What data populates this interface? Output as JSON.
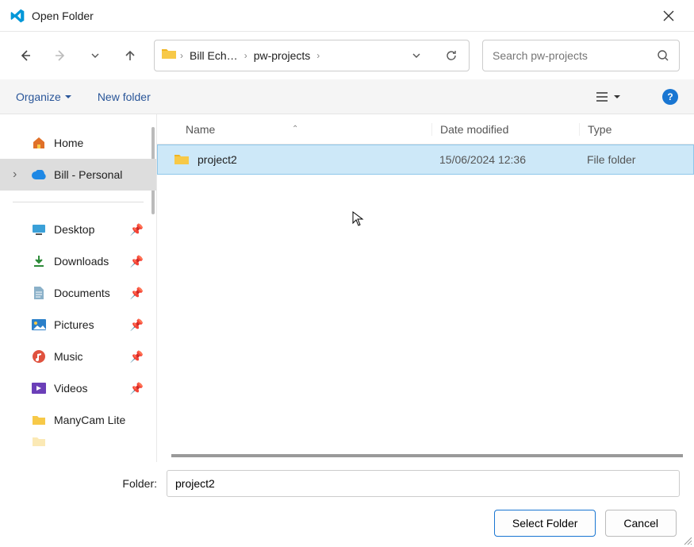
{
  "titlebar": {
    "title": "Open Folder"
  },
  "nav": {
    "breadcrumb": [
      "Bill Ech…",
      "pw-projects"
    ]
  },
  "search": {
    "placeholder": "Search pw-projects"
  },
  "toolbar": {
    "organize": "Organize",
    "newfolder": "New folder",
    "help_symbol": "?"
  },
  "sidebar": {
    "home": "Home",
    "personal": "Bill - Personal",
    "items": [
      {
        "label": "Desktop"
      },
      {
        "label": "Downloads"
      },
      {
        "label": "Documents"
      },
      {
        "label": "Pictures"
      },
      {
        "label": "Music"
      },
      {
        "label": "Videos"
      },
      {
        "label": "ManyCam Lite"
      }
    ]
  },
  "columns": {
    "name": "Name",
    "date": "Date modified",
    "type": "Type"
  },
  "files": [
    {
      "name": "project2",
      "date": "15/06/2024 12:36",
      "type": "File folder"
    }
  ],
  "footer": {
    "folder_label": "Folder:",
    "folder_value": "project2",
    "select": "Select Folder",
    "cancel": "Cancel"
  },
  "colors": {
    "accent": "#1976d2",
    "selection": "#cde8f8"
  }
}
